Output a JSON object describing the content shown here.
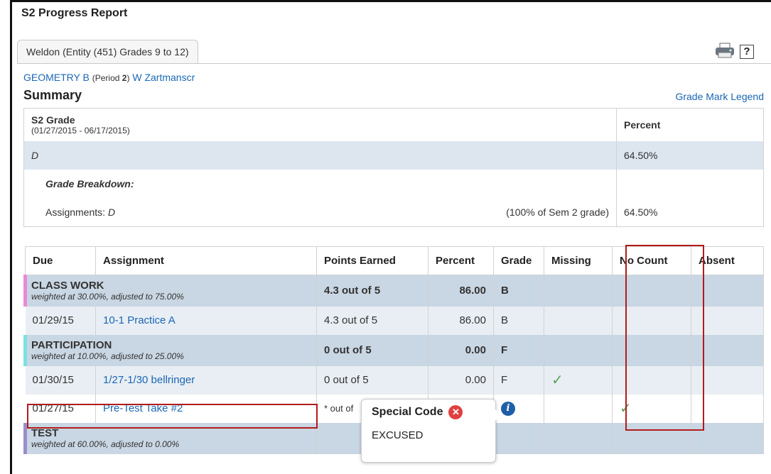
{
  "page_title": "S2 Progress Report",
  "tab_label": "Weldon (Entity (451) Grades 9 to 12)",
  "course": {
    "name": "GEOMETRY B",
    "period_prefix": "(Period ",
    "period": "2",
    "period_suffix": ")",
    "teacher": "W Zartmanscr"
  },
  "summary_label": "Summary",
  "legend_link": "Grade Mark Legend",
  "summary_table": {
    "term_label": "S2 Grade",
    "term_dates": "(01/27/2015 - 06/17/2015)",
    "percent_header": "Percent",
    "grade": "D",
    "percent": "64.50%",
    "breakdown_label": "Grade Breakdown:",
    "assignments_label": "Assignments:",
    "assignments_grade": "D",
    "weight_note": "(100% of Sem 2 grade)",
    "assignments_percent": "64.50%"
  },
  "grades_table": {
    "headers": [
      "Due",
      "Assignment",
      "Points Earned",
      "Percent",
      "Grade",
      "Missing",
      "No Count",
      "Absent"
    ],
    "categories": [
      {
        "name": "CLASS WORK",
        "weight": "weighted at 30.00%, adjusted to 75.00%",
        "points": "4.3 out of 5",
        "percent": "86.00",
        "grade": "B",
        "color": "#e88ad8"
      },
      {
        "name": "PARTICIPATION",
        "weight": "weighted at 10.00%, adjusted to 25.00%",
        "points": "0 out of 5",
        "percent": "0.00",
        "grade": "F",
        "color": "#7fe0e0"
      },
      {
        "name": "TEST",
        "weight": "weighted at 60.00%, adjusted to 0.00%",
        "color": "#9a8fc8"
      }
    ],
    "rows": [
      {
        "due": "01/29/15",
        "assignment": "10-1 Practice A",
        "points": "4.3 out of 5",
        "percent": "86.00",
        "grade": "B"
      },
      {
        "due": "01/30/15",
        "assignment": "1/27-1/30 bellringer",
        "points": "0 out of 5",
        "percent": "0.00",
        "grade": "F"
      },
      {
        "due": "01/27/15",
        "assignment": "Pre-Test Take #2",
        "points": "* out of"
      }
    ]
  },
  "popup": {
    "title": "Special Code",
    "body": "EXCUSED"
  },
  "icons": {
    "printer": "printer-icon",
    "help": "help-icon",
    "info": "info-icon",
    "close": "close-icon",
    "check": "checkmark-icon"
  }
}
